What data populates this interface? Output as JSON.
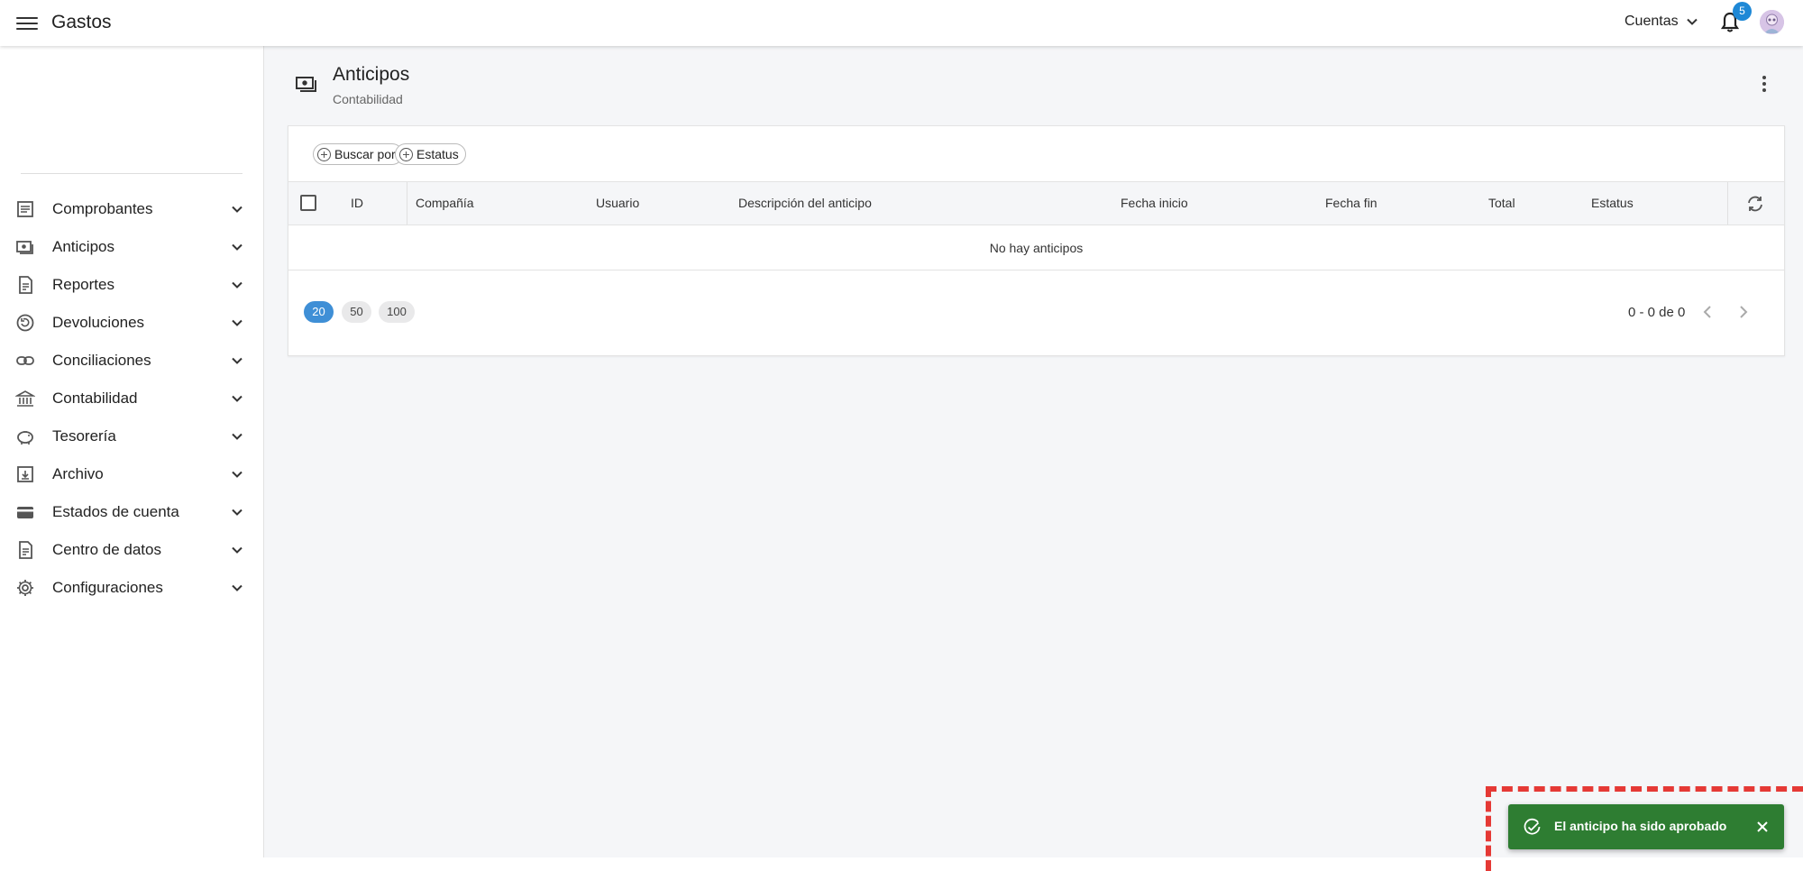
{
  "topbar": {
    "title": "Gastos",
    "accounts_label": "Cuentas",
    "notification_count": "5"
  },
  "sidebar": {
    "items": [
      {
        "label": "Comprobantes",
        "icon": "receipt-icon"
      },
      {
        "label": "Anticipos",
        "icon": "money-icon"
      },
      {
        "label": "Reportes",
        "icon": "report-icon"
      },
      {
        "label": "Devoluciones",
        "icon": "refund-icon"
      },
      {
        "label": "Conciliaciones",
        "icon": "link-icon"
      },
      {
        "label": "Contabilidad",
        "icon": "bank-icon"
      },
      {
        "label": "Tesorería",
        "icon": "piggy-bank-icon"
      },
      {
        "label": "Archivo",
        "icon": "archive-icon"
      },
      {
        "label": "Estados de cuenta",
        "icon": "card-icon"
      },
      {
        "label": "Centro de datos",
        "icon": "data-icon"
      },
      {
        "label": "Configuraciones",
        "icon": "gear-icon"
      }
    ]
  },
  "page": {
    "title": "Anticipos",
    "subtitle": "Contabilidad"
  },
  "filters": {
    "search_by": "Buscar por",
    "status": "Estatus"
  },
  "table": {
    "columns": [
      "ID",
      "Compañía",
      "Usuario",
      "Descripción del anticipo",
      "Fecha inicio",
      "Fecha fin",
      "Total",
      "Estatus"
    ],
    "empty_message": "No hay anticipos"
  },
  "pagination": {
    "sizes": [
      "20",
      "50",
      "100"
    ],
    "selected": "20",
    "range": "0 - 0 de 0"
  },
  "snackbar": {
    "message": "El anticipo ha sido aprobado"
  },
  "colors": {
    "accent": "#3f8fd6",
    "badge": "#1e88d6",
    "success": "#2e7d32",
    "highlight": "#e53935"
  }
}
